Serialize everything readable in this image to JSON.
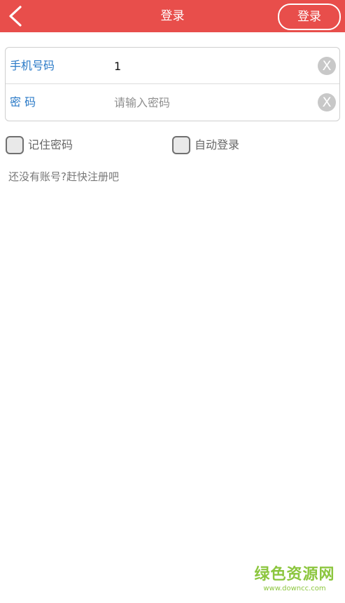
{
  "header": {
    "back_icon": "chevron-left-icon",
    "title": "登录",
    "login_button": "登录",
    "color": "#e84e4b"
  },
  "form": {
    "phone": {
      "label": "手机号码",
      "value": "1",
      "placeholder": ""
    },
    "password": {
      "label": "密 码",
      "value": "",
      "placeholder": "请输入密码"
    },
    "clear_icon": "X"
  },
  "options": {
    "remember_password": "记住密码",
    "auto_login": "自动登录"
  },
  "register_text": "还没有账号?赶快注册吧",
  "watermark": {
    "cn": "绿色资源网",
    "en": "www.downcc.com",
    "color": "#8cc63e"
  },
  "colors": {
    "label_blue": "#2a7ac7"
  }
}
